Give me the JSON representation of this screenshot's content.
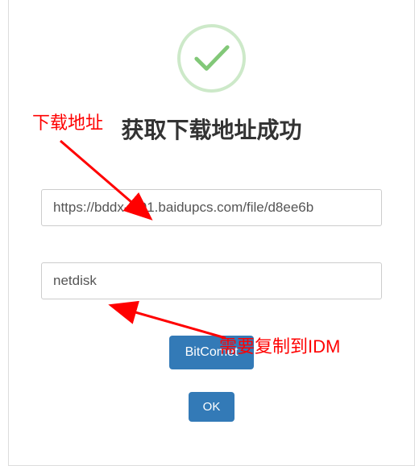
{
  "dialog": {
    "title": "获取下载地址成功",
    "url_field": "https://bddx-ct01.baidupcs.com/file/d8ee6b",
    "useragent_field": "netdisk",
    "bitcomet_button": "BitComet",
    "ok_button": "OK"
  },
  "annotations": {
    "top_label": "下载地址",
    "bottom_label": "需要复制到IDM"
  }
}
